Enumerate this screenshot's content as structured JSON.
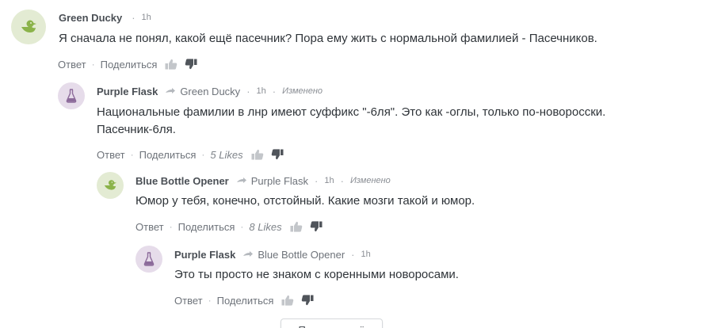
{
  "comments": [
    {
      "author": "Green Ducky",
      "avatar_icon": "duck-icon",
      "avatar_color": "#e3ebd3",
      "time": "1h",
      "text_lines": [
        "Я сначала не понял, какой ещё пасечник? Пора ему жить с нормальной фамилией - Пасечников."
      ],
      "reply_label": "Ответ",
      "share_label": "Поделиться"
    },
    {
      "author": "Purple Flask",
      "avatar_icon": "flask-icon",
      "avatar_color": "#e6dcea",
      "reply_to": "Green Ducky",
      "time": "1h",
      "edited": "Изменено",
      "text_lines": [
        "Национальные фамилии в лнр имеют суффикс \"-6ля\". Это как -оглы, только по-новоросски.",
        "Пасечник-6ля."
      ],
      "reply_label": "Ответ",
      "share_label": "Поделиться",
      "likes": "5 Likes"
    },
    {
      "author": "Blue Bottle Opener",
      "avatar_icon": "duck-icon",
      "avatar_color": "#e3ebd3",
      "reply_to": "Purple Flask",
      "time": "1h",
      "edited": "Изменено",
      "text_lines": [
        "Юмор у тебя, конечно, отстойный. Какие мозги такой и юмор."
      ],
      "reply_label": "Ответ",
      "share_label": "Поделиться",
      "likes": "8 Likes"
    },
    {
      "author": "Purple Flask",
      "avatar_icon": "flask-icon",
      "avatar_color": "#e6dcea",
      "reply_to": "Blue Bottle Opener",
      "time": "1h",
      "text_lines": [
        "Это ты просто не знаком с коренными новоросами."
      ],
      "reply_label": "Ответ",
      "share_label": "Поделиться"
    }
  ],
  "load_more_label": "Показать ещё"
}
